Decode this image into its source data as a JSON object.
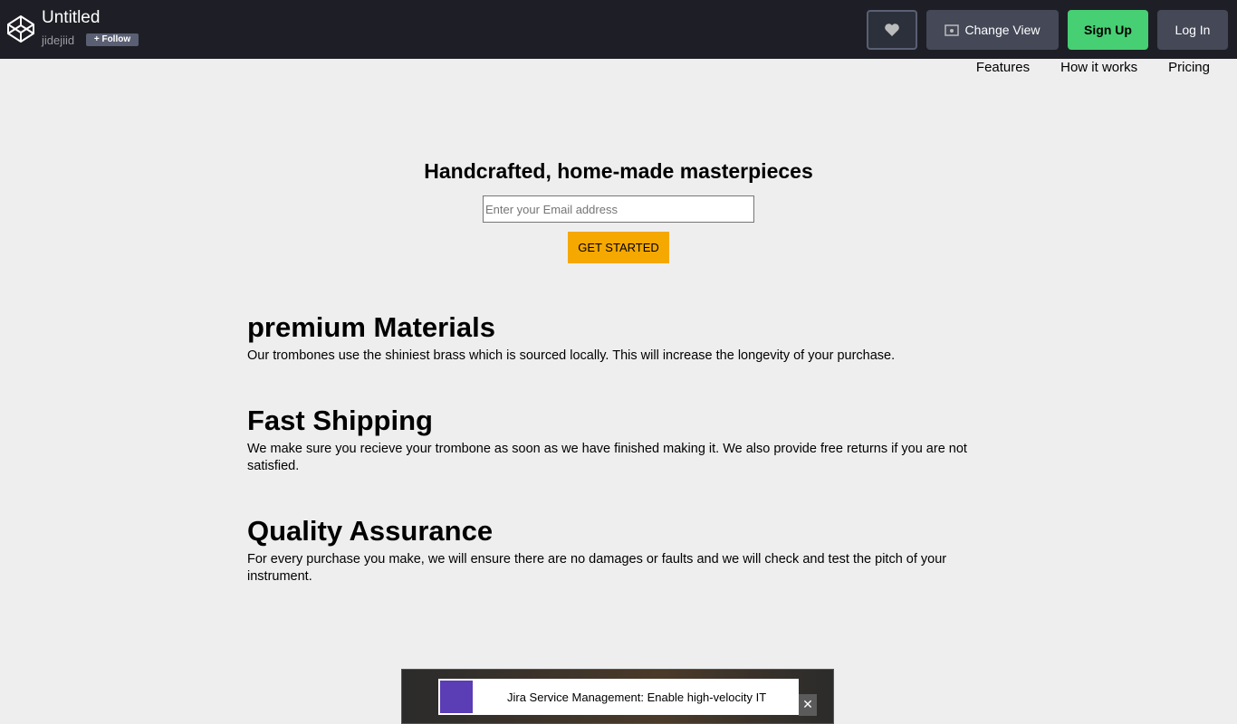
{
  "header": {
    "title": "Untitled",
    "user": "jidejiid",
    "follow_label": "Follow",
    "change_view_label": "Change View",
    "signup_label": "Sign Up",
    "login_label": "Log In"
  },
  "nav": {
    "items": [
      "Features",
      "How it works",
      "Pricing"
    ]
  },
  "hero": {
    "title": "Handcrafted, home-made masterpieces",
    "email_placeholder": "Enter your Email address",
    "cta_label": "GET STARTED"
  },
  "features": [
    {
      "title": "premium Materials",
      "text": "Our trombones use the shiniest brass which is sourced locally. This will increase the longevity of your purchase."
    },
    {
      "title": "Fast Shipping",
      "text": "We make sure you recieve your trombone as soon as we have finished making it. We also provide free returns if you are not satisfied."
    },
    {
      "title": "Quality Assurance",
      "text": "For every purchase you make, we will ensure there are no damages or faults and we will check and test the pitch of your instrument."
    }
  ],
  "ad": {
    "text": "Jira Service Management: Enable high-velocity IT",
    "close_label": "✕"
  },
  "colors": {
    "topbar": "#1e1f26",
    "signup": "#47cf73",
    "cta": "#f5a800",
    "page_bg": "#eeeeee"
  }
}
